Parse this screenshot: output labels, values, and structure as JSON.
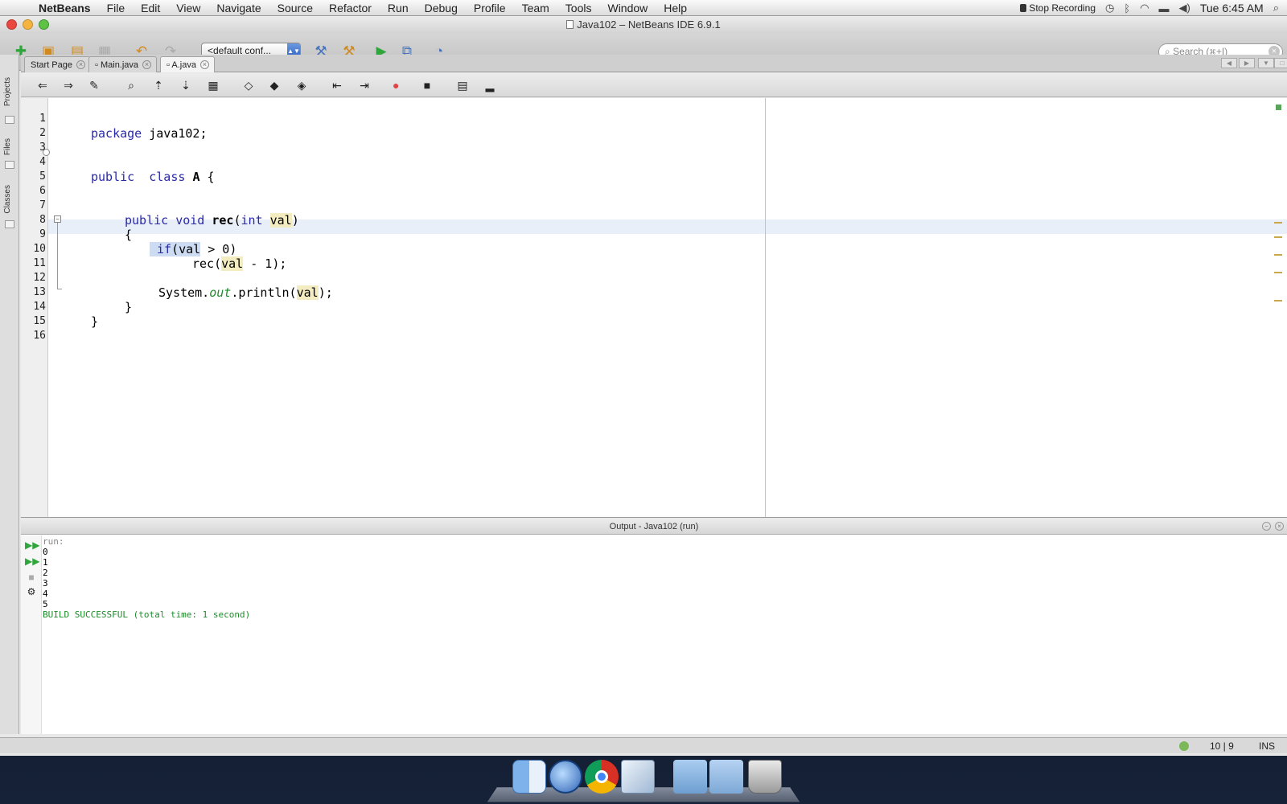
{
  "menubar": {
    "app_name": "NetBeans",
    "items": [
      "File",
      "Edit",
      "View",
      "Navigate",
      "Source",
      "Refactor",
      "Run",
      "Debug",
      "Profile",
      "Team",
      "Tools",
      "Window",
      "Help"
    ],
    "stop_recording": "Stop Recording",
    "clock": "Tue 6:45 AM"
  },
  "window": {
    "title": "Java102 – NetBeans IDE 6.9.1"
  },
  "toolbar": {
    "config_value": "<default conf...",
    "search_placeholder": "Search (⌘+I)"
  },
  "side_tabs": [
    "Projects",
    "Files",
    "Classes"
  ],
  "tabs": [
    {
      "label": "Start Page"
    },
    {
      "label": "Main.java"
    },
    {
      "label": "A.java"
    }
  ],
  "editor": {
    "line_numbers": [
      "1",
      "2",
      "3",
      "4",
      "5",
      "6",
      "7",
      "8",
      "9",
      "10",
      "11",
      "12",
      "13",
      "14",
      "15",
      "16"
    ],
    "current_line": 10
  },
  "output": {
    "title": "Output - Java102 (run)",
    "lines": [
      "run:",
      "0",
      "1",
      "2",
      "3",
      "4",
      "5",
      "BUILD SUCCESSFUL (total time: 1 second)"
    ]
  },
  "statusbar": {
    "position": "10 | 9",
    "mode": "INS"
  },
  "colors": {
    "keyword": "#2a2aa8",
    "variable_highlight": "#f2ecc0",
    "static_field": "#1e8b2b",
    "build_success": "#1e8b2b",
    "selection": "#cddcf2"
  },
  "icons": {
    "new_file": "new-file-icon",
    "new_project": "new-project-icon",
    "open_project": "open-project-icon",
    "run": "run-icon",
    "build": "hammer-icon",
    "clean_build": "clean-build-icon",
    "debug": "debug-icon",
    "profile": "profile-icon"
  }
}
